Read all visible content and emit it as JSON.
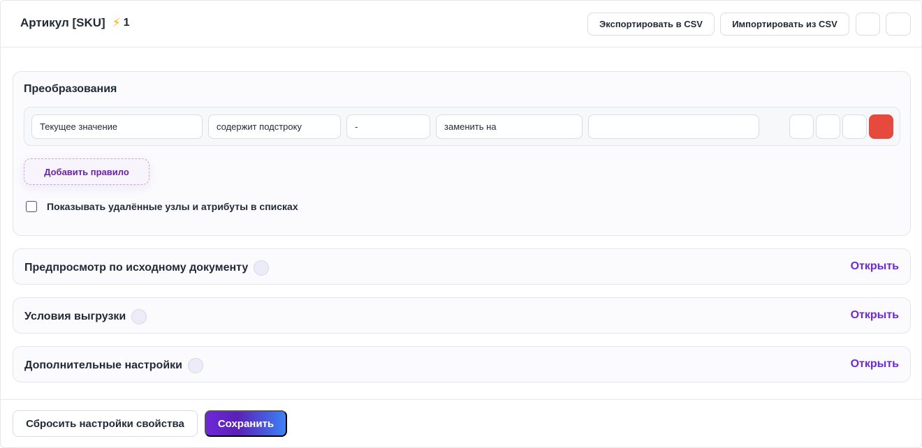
{
  "header": {
    "title": "Артикул [SKU]",
    "bolt_icon": "lightning-icon",
    "count": "1",
    "export_label": "Экспортировать в CSV",
    "import_label": "Импортировать из CSV"
  },
  "transformations": {
    "title": "Преобразования",
    "rules": [
      {
        "source": "Текущее значение",
        "condition": "содержит подстроку",
        "value": "-",
        "action": "заменить на",
        "replacement": ""
      }
    ],
    "add_rule_label": "Добавить правило",
    "show_deleted_label": "Показывать удалённые узлы и атрибуты в списках",
    "show_deleted_checked": false,
    "delete_color": "#e54a3d"
  },
  "sections": [
    {
      "title": "Предпросмотр по исходному документу",
      "action": "Открыть"
    },
    {
      "title": "Условия выгрузки",
      "action": "Открыть"
    },
    {
      "title": "Дополнительные настройки",
      "action": "Открыть"
    }
  ],
  "footer": {
    "reset_label": "Сбросить настройки свойства",
    "save_label": "Сохранить"
  },
  "colors": {
    "accent": "#6d28d9",
    "save_gradient_end": "#3b82f6"
  }
}
